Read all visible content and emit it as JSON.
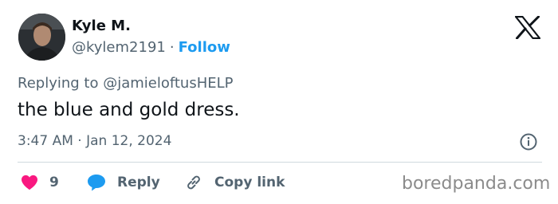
{
  "author": {
    "display_name": "Kyle M.",
    "handle": "@kylem2191",
    "separator": "·",
    "follow_label": "Follow"
  },
  "tweet": {
    "replying_to": "Replying to @jamieloftusHELP",
    "text": "the blue and gold dress.",
    "timestamp": "3:47 AM · Jan 12, 2024"
  },
  "actions": {
    "like_count": "9",
    "reply_label": "Reply",
    "copy_link_label": "Copy link"
  },
  "icons": {
    "brand": "x-logo-icon",
    "info": "info-icon",
    "like": "heart-icon",
    "reply": "speech-bubble-icon",
    "copy": "link-icon"
  },
  "colors": {
    "accent": "#1d9bf0",
    "like": "#f91880",
    "text": "#0f1419",
    "muted": "#536471"
  },
  "watermark": "boredpanda.com"
}
